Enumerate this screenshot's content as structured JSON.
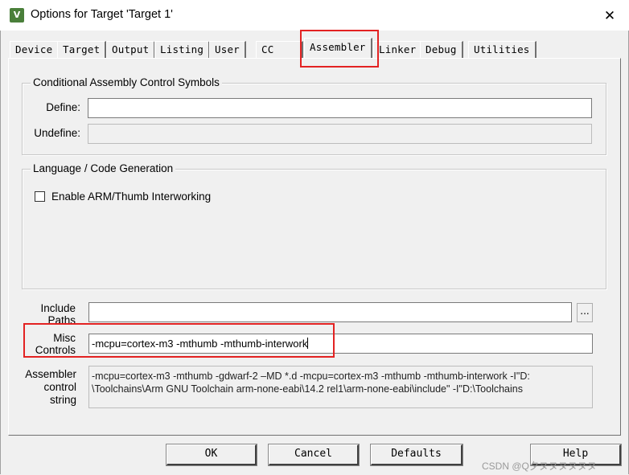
{
  "window": {
    "title": "Options for Target 'Target 1'",
    "icon_text": "V",
    "close_glyph": "✕"
  },
  "tabs": [
    {
      "label": "Device"
    },
    {
      "label": "Target"
    },
    {
      "label": "Output"
    },
    {
      "label": "Listing"
    },
    {
      "label": "User"
    },
    {
      "label": "CC"
    },
    {
      "label": "Assembler",
      "active": true
    },
    {
      "label": "Linker"
    },
    {
      "label": "Debug"
    },
    {
      "label": "Utilities"
    }
  ],
  "conditional_group": {
    "legend": "Conditional Assembly Control Symbols",
    "define_label": "Define:",
    "define_value": "",
    "undefine_label": "Undefine:",
    "undefine_value": ""
  },
  "language_group": {
    "legend": "Language / Code Generation",
    "interwork_label": "Enable ARM/Thumb Interworking",
    "interwork_checked": false
  },
  "include_paths": {
    "label_line1": "Include",
    "label_line2": "Paths",
    "value": "",
    "browse_label": "..."
  },
  "misc_controls": {
    "label_line1": "Misc",
    "label_line2": "Controls",
    "value": "-mcpu=cortex-m3 -mthumb -mthumb-interwork"
  },
  "control_string": {
    "label_line1": "Assembler",
    "label_line2": "control",
    "label_line3": "string",
    "line1": "-mcpu=cortex-m3 -mthumb -gdwarf-2 –MD *.d -mcpu=cortex-m3 -mthumb -mthumb-interwork -I\"D:",
    "line2": "\\Toolchains\\Arm GNU Toolchain arm-none-eabi\\14.2 rel1\\arm-none-eabi\\include\" -I\"D:\\Toolchains"
  },
  "buttons": {
    "ok": "OK",
    "cancel": "Cancel",
    "defaults": "Defaults",
    "help": "Help"
  },
  "watermark": "CSDN @Q夕ヌヌヌヌヌヌ",
  "colors": {
    "highlight": "#e32222",
    "dialog_bg": "#f0f0f0"
  }
}
